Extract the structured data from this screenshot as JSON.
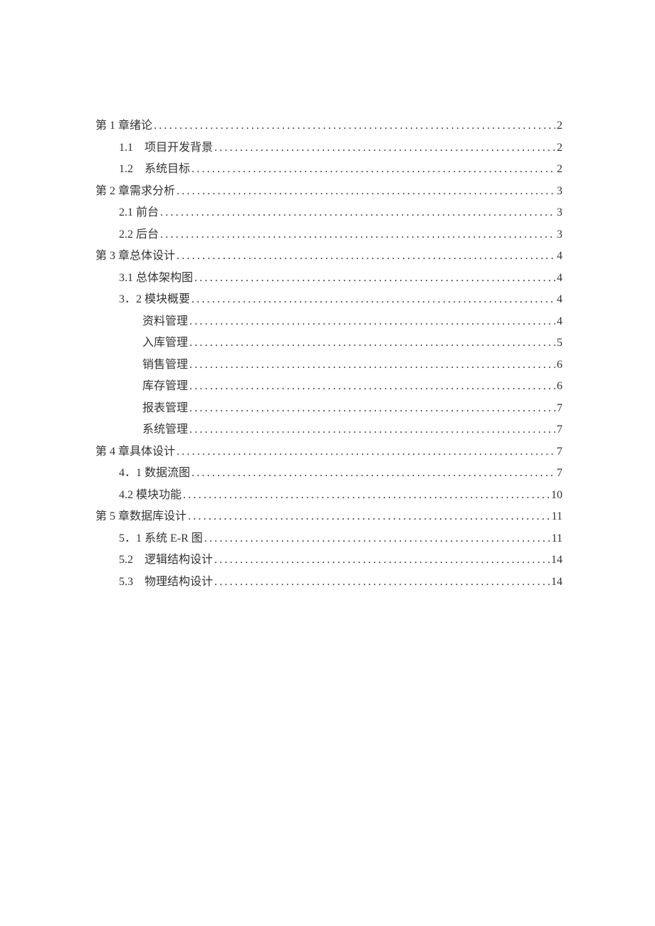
{
  "toc": [
    {
      "indent": 0,
      "label": "第 1 章绪论",
      "page": "2"
    },
    {
      "indent": 1,
      "label": "1.1 项目开发背景",
      "page": "2"
    },
    {
      "indent": 1,
      "label": "1.2 系统目标",
      "page": "2"
    },
    {
      "indent": 0,
      "label": "第 2 章需求分析",
      "page": "3"
    },
    {
      "indent": 1,
      "label": "2.1 前台",
      "page": "3"
    },
    {
      "indent": 1,
      "label": "2.2 后台",
      "page": "3"
    },
    {
      "indent": 0,
      "label": "第 3 章总体设计",
      "page": "4"
    },
    {
      "indent": 1,
      "label": "3.1 总体架构图",
      "page": "4"
    },
    {
      "indent": 1,
      "label": "3．2 模块概要",
      "page": "4"
    },
    {
      "indent": 2,
      "label": "资料管理",
      "page": "4"
    },
    {
      "indent": 2,
      "label": "入库管理",
      "page": "5"
    },
    {
      "indent": 2,
      "label": "销售管理",
      "page": "6"
    },
    {
      "indent": 2,
      "label": "库存管理",
      "page": "6"
    },
    {
      "indent": 2,
      "label": "报表管理",
      "page": "7"
    },
    {
      "indent": 2,
      "label": "系统管理",
      "page": "7"
    },
    {
      "indent": 0,
      "label": "第 4 章具体设计",
      "page": "7"
    },
    {
      "indent": 1,
      "label": "4．1 数据流图",
      "page": "7"
    },
    {
      "indent": 1,
      "label": "4.2 模块功能",
      "page": "10"
    },
    {
      "indent": 0,
      "label": "第 5 章数据库设计",
      "page": "11"
    },
    {
      "indent": 1,
      "label": "5．1 系统 E-R 图",
      "page": "11"
    },
    {
      "indent": 1,
      "label": "5.2 逻辑结构设计",
      "page": "14"
    },
    {
      "indent": 1,
      "label": "5.3 物理结构设计",
      "page": "14"
    }
  ]
}
